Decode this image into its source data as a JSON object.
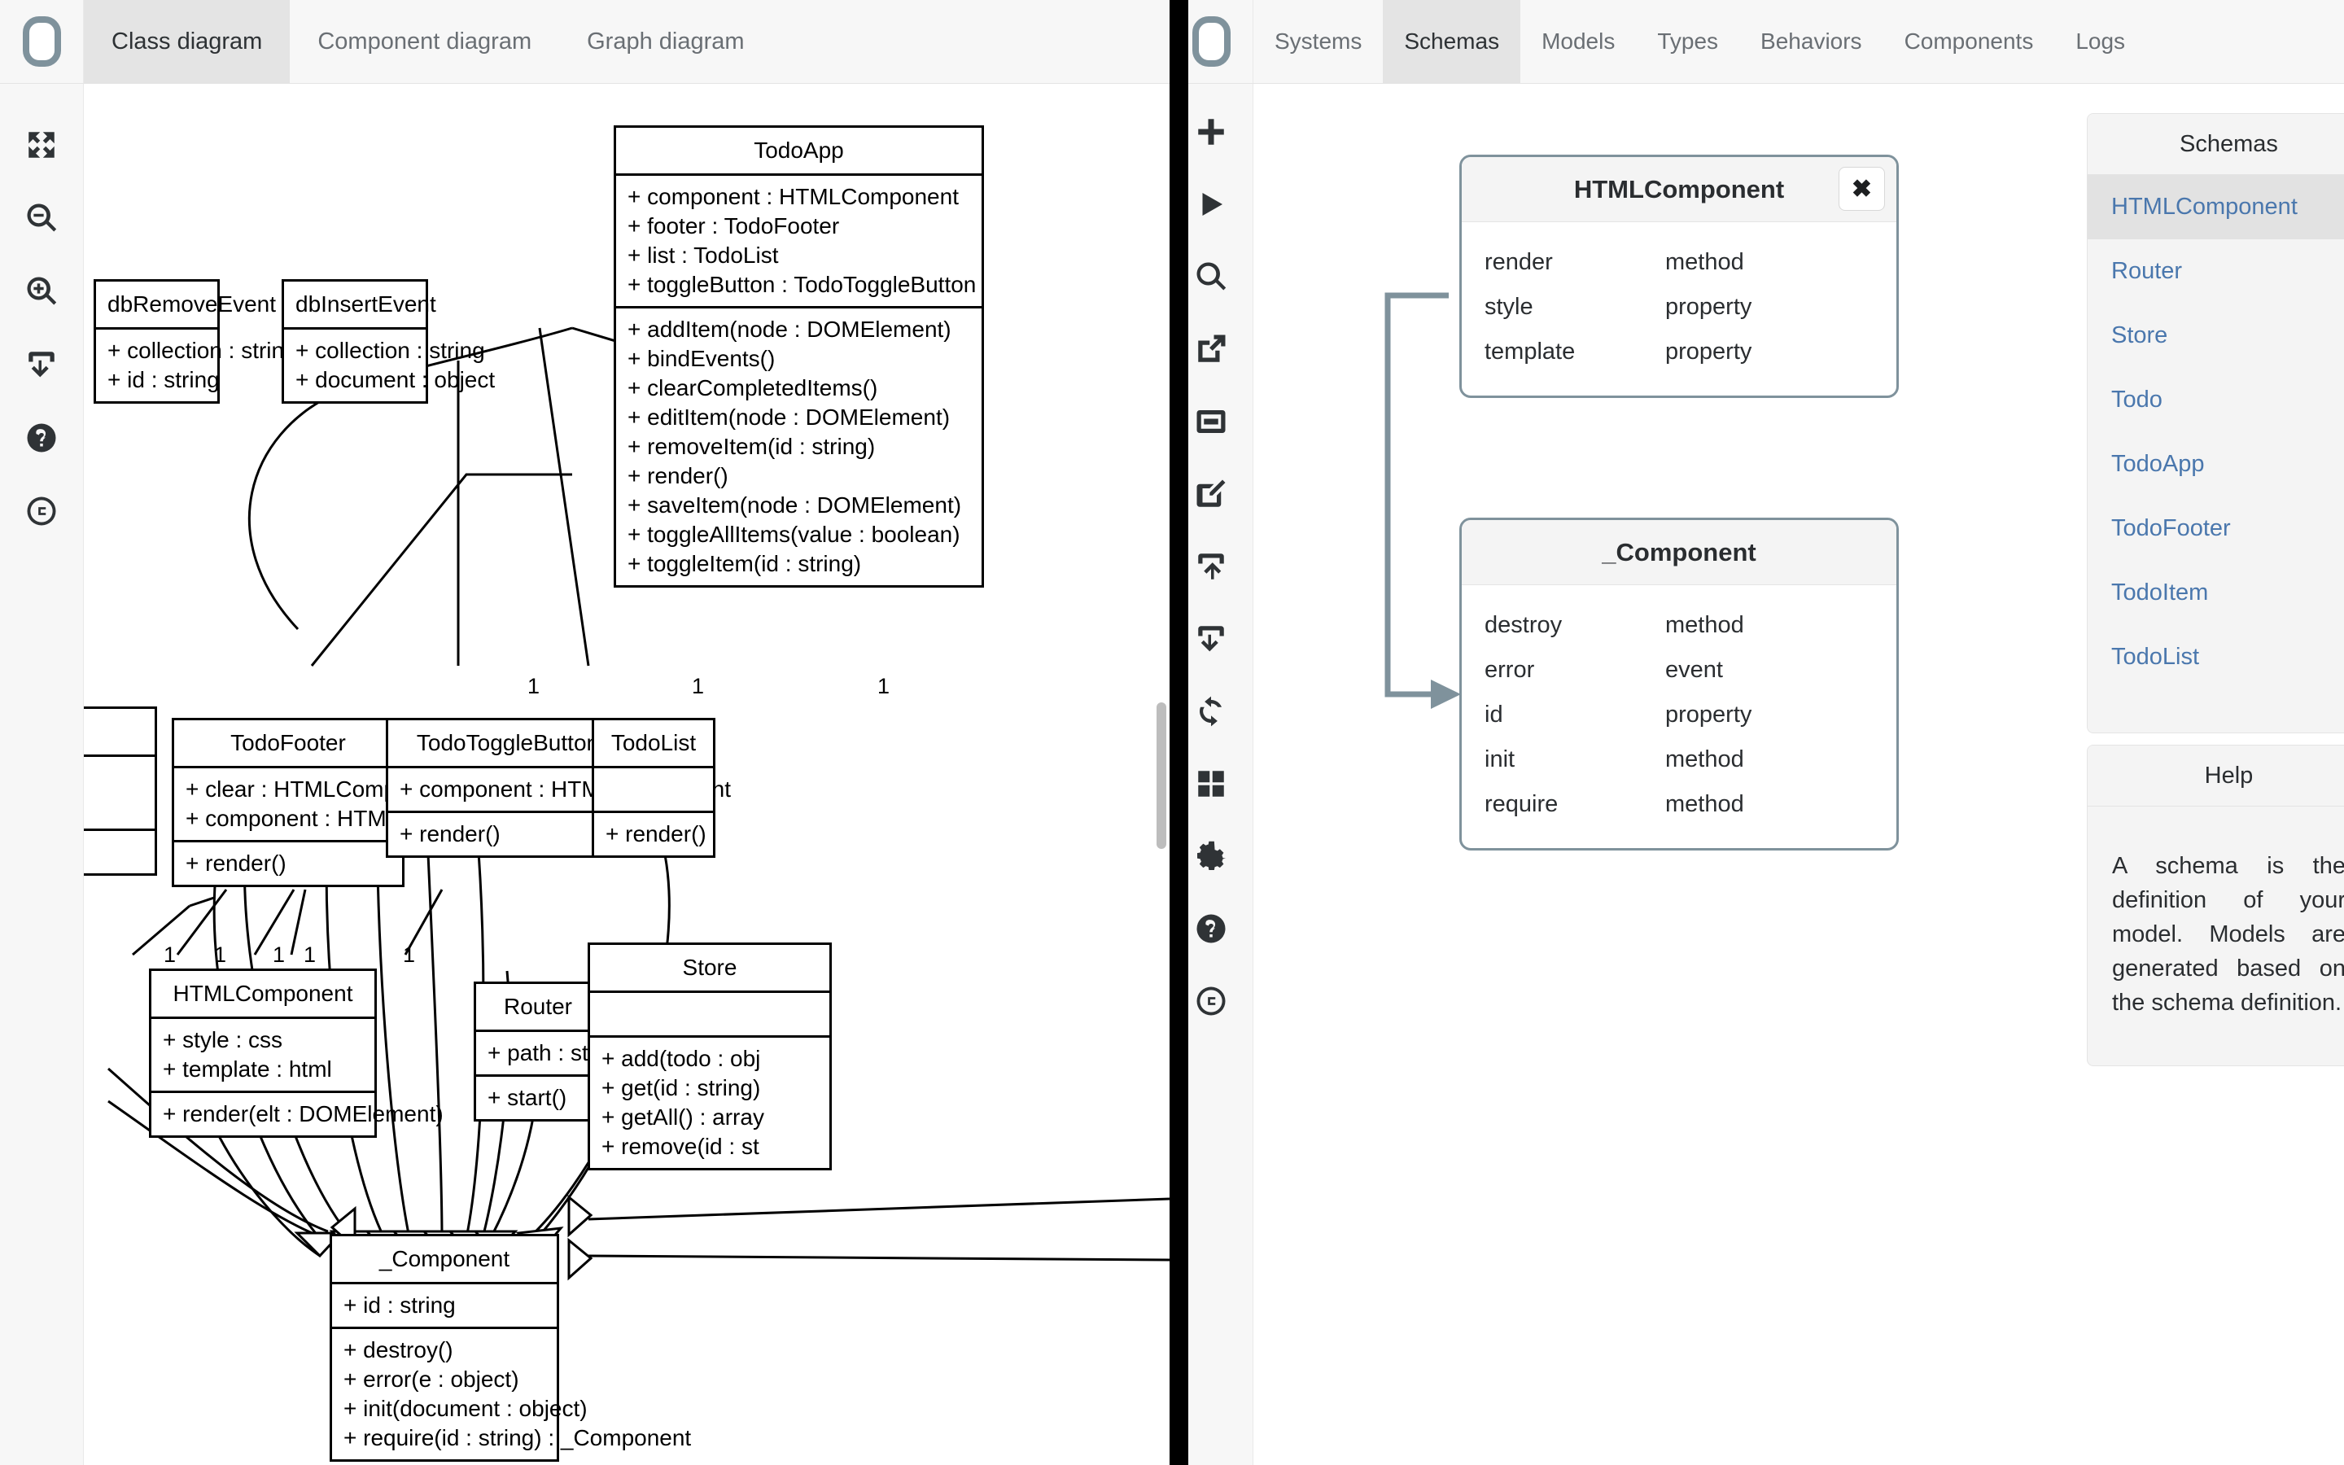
{
  "left_app": {
    "tabs": [
      {
        "label": "Class diagram",
        "active": true
      },
      {
        "label": "Component diagram",
        "active": false
      },
      {
        "label": "Graph diagram",
        "active": false
      }
    ],
    "toolbar": [
      {
        "name": "fullscreen-icon",
        "title": "Fit to screen"
      },
      {
        "name": "zoom-out-icon",
        "title": "Zoom out"
      },
      {
        "name": "zoom-in-icon",
        "title": "Zoom in"
      },
      {
        "name": "download-icon",
        "title": "Download"
      },
      {
        "name": "help-icon",
        "title": "Help"
      },
      {
        "name": "copyright-icon",
        "title": "About"
      }
    ],
    "diagram": {
      "classes": [
        {
          "id": "todoapp",
          "name": "TodoApp",
          "attributes": [
            "+ component : HTMLComponent",
            "+ footer : TodoFooter",
            "+ list : TodoList",
            "+ toggleButton : TodoToggleButton"
          ],
          "methods": [
            "+ addItem(node : DOMElement)",
            "+ bindEvents()",
            "+ clearCompletedItems()",
            "+ editItem(node : DOMElement)",
            "+ removeItem(id : string)",
            "+ render()",
            "+ saveItem(node : DOMElement)",
            "+ toggleAllItems(value : boolean)",
            "+ toggleItem(id : string)"
          ]
        },
        {
          "id": "dbremoveevent",
          "name": "dbRemoveEvent",
          "attributes": [
            "+ collection : string",
            "+ id : string"
          ],
          "methods": []
        },
        {
          "id": "dbinsertevent",
          "name": "dbInsertEvent",
          "attributes": [
            "+ collection : string",
            "+ document : object"
          ],
          "methods": []
        },
        {
          "id": "todofooter",
          "name": "TodoFooter",
          "attributes": [
            "+ clear : HTMLComponent",
            "+ component : HTMLComponent"
          ],
          "methods": [
            "+ render()"
          ]
        },
        {
          "id": "todotogglebutton",
          "name": "TodoToggleButton",
          "attributes": [
            "+ component : HTMLComponent"
          ],
          "methods": [
            "+ render()"
          ]
        },
        {
          "id": "todolist",
          "name": "TodoList",
          "attributes": [
            ""
          ],
          "methods": [
            "+ render()"
          ]
        },
        {
          "id": "htmlcomponent",
          "name": "HTMLComponent",
          "attributes": [
            "+ style : css",
            "+ template : html"
          ],
          "methods": [
            "+ render(elt : DOMElement)"
          ]
        },
        {
          "id": "router",
          "name": "Router",
          "attributes": [
            "+ path : string"
          ],
          "methods": [
            "+ start()"
          ]
        },
        {
          "id": "store",
          "name": "Store",
          "attributes": [
            ""
          ],
          "methods": [
            "+ add(todo : obj",
            "+ get(id : string)",
            "+ getAll() : array",
            "+ remove(id : st"
          ]
        },
        {
          "id": "component",
          "name": "_Component",
          "attributes": [
            "+ id : string"
          ],
          "methods": [
            "+ destroy()",
            "+ error(e : object)",
            "+ init(document : object)",
            "+ require(id : string) : _Component"
          ]
        },
        {
          "id": "clipped",
          "name": "",
          "attributes": [
            "nt"
          ],
          "methods": [
            ""
          ]
        }
      ],
      "multiplicities": [
        "1",
        "1",
        "1",
        "1",
        "1",
        "1",
        "1",
        "1"
      ]
    }
  },
  "right_app": {
    "tabs": [
      {
        "label": "Systems",
        "active": false
      },
      {
        "label": "Schemas",
        "active": true
      },
      {
        "label": "Models",
        "active": false
      },
      {
        "label": "Types",
        "active": false
      },
      {
        "label": "Behaviors",
        "active": false
      },
      {
        "label": "Components",
        "active": false
      },
      {
        "label": "Logs",
        "active": false
      }
    ],
    "toolbar": [
      {
        "name": "plus-icon",
        "title": "Add"
      },
      {
        "name": "play-icon",
        "title": "Run"
      },
      {
        "name": "search-icon",
        "title": "Search"
      },
      {
        "name": "external-link-icon",
        "title": "Open"
      },
      {
        "name": "window-icon",
        "title": "Window"
      },
      {
        "name": "edit-icon",
        "title": "Edit"
      },
      {
        "name": "upload-icon",
        "title": "Upload"
      },
      {
        "name": "download-icon",
        "title": "Download"
      },
      {
        "name": "refresh-icon",
        "title": "Refresh"
      },
      {
        "name": "grid-icon",
        "title": "Grid"
      },
      {
        "name": "gear-icon",
        "title": "Settings"
      },
      {
        "name": "help-icon",
        "title": "Help"
      },
      {
        "name": "copyright-icon",
        "title": "About"
      }
    ],
    "cards": [
      {
        "id": "htmlcomponent",
        "title": "HTMLComponent",
        "close_label": "✖",
        "rows": [
          {
            "key": "render",
            "value": "method"
          },
          {
            "key": "style",
            "value": "property"
          },
          {
            "key": "template",
            "value": "property"
          }
        ]
      },
      {
        "id": "component",
        "title": "_Component",
        "rows": [
          {
            "key": "destroy",
            "value": "method"
          },
          {
            "key": "error",
            "value": "event"
          },
          {
            "key": "id",
            "value": "property"
          },
          {
            "key": "init",
            "value": "method"
          },
          {
            "key": "require",
            "value": "method"
          }
        ]
      }
    ],
    "schemas_panel": {
      "title": "Schemas",
      "items": [
        {
          "label": "HTMLComponent",
          "selected": true
        },
        {
          "label": "Router",
          "selected": false
        },
        {
          "label": "Store",
          "selected": false
        },
        {
          "label": "Todo",
          "selected": false
        },
        {
          "label": "TodoApp",
          "selected": false
        },
        {
          "label": "TodoFooter",
          "selected": false
        },
        {
          "label": "TodoItem",
          "selected": false
        },
        {
          "label": "TodoList",
          "selected": false
        }
      ]
    },
    "help_panel": {
      "title": "Help",
      "text": "A schema is the definition of your model. Models are generated based on the schema definition."
    }
  },
  "colors": {
    "accent": "#7f929c",
    "link": "#4a77ad",
    "tab_active_bg": "#e4e4e4",
    "panel_bg": "#f4f4f4",
    "divider": "#000000"
  }
}
